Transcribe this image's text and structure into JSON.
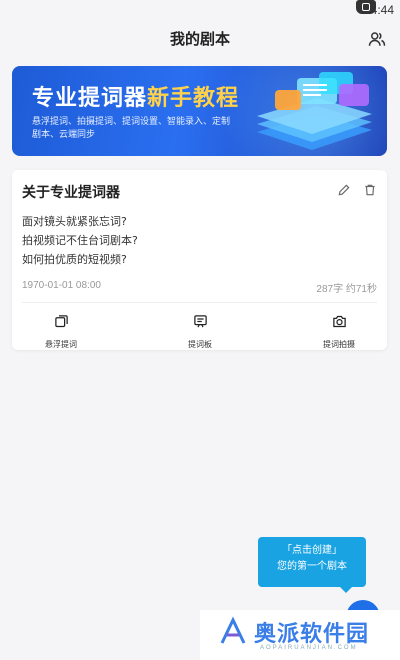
{
  "status_bar": {
    "time": "4:44"
  },
  "header": {
    "title": "我的剧本",
    "profile_icon": "users-icon"
  },
  "banner": {
    "title_main": "专业提词器",
    "title_accent": "新手教程",
    "subtitle": "悬浮提词、拍摄提词、提词设置、智能录入、定制剧本、云端同步"
  },
  "script_card": {
    "title": "关于专业提词器",
    "lines": [
      "面对镜头就紧张忘词?",
      "拍视频记不住台词剧本?",
      "如何拍优质的短视频?"
    ],
    "date": "1970-01-01 08:00",
    "count": "287字 约71秒",
    "actions": [
      {
        "label": "悬浮提词",
        "icon": "float-window-icon"
      },
      {
        "label": "提词板",
        "icon": "prompter-board-icon"
      },
      {
        "label": "提词拍摄",
        "icon": "camera-icon"
      }
    ]
  },
  "tooltip": {
    "line1": "「点击创建」",
    "line2": "您的第一个剧本"
  },
  "watermark": {
    "text": "奥派软件园",
    "sub": "AOPAIRUANJIAN.COM"
  },
  "colors": {
    "accent": "#1f6fe8",
    "tooltip": "#1aa3e3",
    "banner_accent": "#ffd24a"
  }
}
